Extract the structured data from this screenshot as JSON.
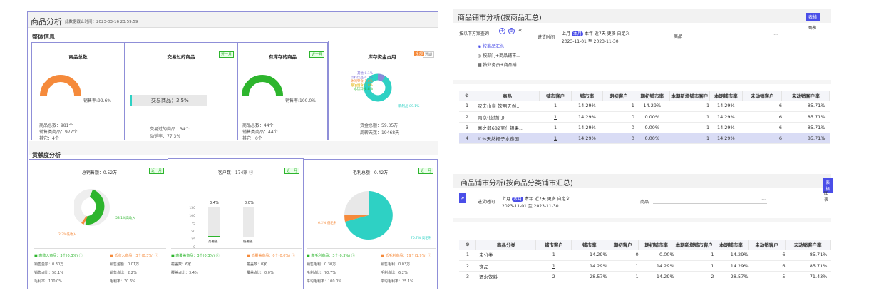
{
  "left": {
    "title": "商品分析",
    "deadline": "此数据截止时间：2023-03-16 23:59:59",
    "overview_label": "整体信息",
    "contribution_label": "贡献度分析",
    "recent_month": "近一月",
    "recent_month_sm": "近一月",
    "btn_all": "全部",
    "btn_recent": "近期",
    "cards": {
      "total": {
        "title": "商品总数",
        "rate": "销售率:99.6%",
        "lines": [
          "商品总数：981个",
          "销售类商品：977个",
          "其它：4个"
        ],
        "rate_value": 99.6
      },
      "traded": {
        "title": "交易过的商品",
        "bar_label": "交易商品：3.5%",
        "lines": [
          "交易过的商品：34个",
          "动销率：77.3%"
        ],
        "bar_value": 3.5
      },
      "stock": {
        "title": "有库存的商品",
        "rate": "销售率:100.0%",
        "lines": [
          "商品总数：44个",
          "销售类商品：44个",
          "其它：0个"
        ],
        "rate_value": 100.0
      },
      "capital": {
        "title": "库存资金占用",
        "labels": [
          "其他-0.1%",
          "饮料饮品-0.2%",
          "休闲零食-1.0%",
          "粮油副食-2.8%",
          "水饮料-6.8%",
          "乳制品-89.1%"
        ],
        "lines": [
          "资金总额：59.35万",
          "周转天数：19468天"
        ]
      }
    },
    "contrib": {
      "sales": {
        "title": "总销售额：0.52万",
        "big_label": "58.1%高收入",
        "small_label": "2.3%低收入",
        "left": [
          "■ 高收入商品：3个(0.3%) ⓘ",
          "销售金额：0.30万",
          "销售占比：58.1%",
          "毛利率：100.0%"
        ],
        "right": [
          "■ 低收入商品：3个(0.3%) ⓘ",
          "销售金额：0.01万",
          "销售占比：2.2%",
          "毛利率：70.6%"
        ]
      },
      "customers": {
        "title": "客户数：174家 ⓘ",
        "bar1_label": "3.4%",
        "bar2_label": "0.0%",
        "ticks": [
          "150",
          "100",
          "75",
          "50",
          "25",
          "0"
        ],
        "cats": [
          "高覆盖",
          "低覆盖"
        ],
        "left": [
          "■ 高覆盖商品：3个(0.3%) ⓘ",
          "覆盖数：6家",
          "覆盖占比：3.4%"
        ],
        "right": [
          "■ 低覆盖商品：0个(0.0%) ⓘ",
          "覆盖数：0家",
          "覆盖占比：0.0%"
        ]
      },
      "profit": {
        "title": "毛利总额：0.42万",
        "big_label": "70.7% 高毛利",
        "small_label": "6.2% 低毛利",
        "left": [
          "■ 高毛利商品：3个(0.3%) ⓘ",
          "销售毛利：0.30万",
          "毛利占比：70.7%",
          "平均毛利率：100.0%"
        ],
        "right": [
          "■ 低毛利商品：19个(1.9%) ⓘ",
          "销售毛利：0.03万",
          "毛利占比：6.2%",
          "平均毛利率：25.1%"
        ]
      }
    }
  },
  "right1": {
    "title": "商品铺市分析(按商品汇总)",
    "btn_table": "表格",
    "btn_chart": "图表",
    "query_label": "按以下方案查询",
    "options": [
      "按商品汇总",
      "按部门+商品铺市...",
      "按业务员+商品铺..."
    ],
    "time_label": "进货时间",
    "periods": [
      "上月",
      "本月",
      "本年",
      "近7天",
      "更多",
      "自定义"
    ],
    "date_range": "2023-11-01 至 2023-11-30",
    "goods_label": "商品",
    "more": "···",
    "headers": [
      "商品",
      "铺市客户",
      "铺市率",
      "期初客户",
      "期初铺市率",
      "本期新增铺市客户",
      "本期铺市率",
      "未动销客户",
      "未动销客户率"
    ],
    "rows": [
      [
        "1",
        "农夫山泉 饮用天然...",
        "1",
        "14.29%",
        "1",
        "14.29%",
        "1",
        "14.29%",
        "6",
        "85.71%"
      ],
      [
        "2",
        "南京(炫赫门)",
        "1",
        "14.29%",
        "0",
        "0.00%",
        "1",
        "14.29%",
        "6",
        "85.71%"
      ],
      [
        "3",
        "喜之郎682克什锦果...",
        "1",
        "14.29%",
        "0",
        "0.00%",
        "1",
        "14.29%",
        "6",
        "85.71%"
      ],
      [
        "4",
        "if %天然椰子水泰国...",
        "1",
        "14.29%",
        "0",
        "0.00%",
        "1",
        "14.29%",
        "6",
        "85.71%"
      ]
    ]
  },
  "right2": {
    "title": "商品铺市分析(按商品分类铺市汇总)",
    "btn_table": "表格",
    "btn_chart": "图表",
    "time_label": "进货时间",
    "periods": [
      "上月",
      "本月",
      "本年",
      "近7天",
      "更多",
      "自定义"
    ],
    "date_range": "2023-11-01 至 2023-11-30",
    "goods_label": "商品",
    "more": "···",
    "expand": "»",
    "headers": [
      "商品分类",
      "铺市客户",
      "铺市率",
      "期初客户",
      "期初铺市率",
      "本期新增铺市客户",
      "本期铺市率",
      "未动销客户",
      "未动销客户率"
    ],
    "rows": [
      [
        "1",
        "未分类",
        "1",
        "14.29%",
        "0",
        "0.00%",
        "1",
        "14.29%",
        "6",
        "85.71%"
      ],
      [
        "2",
        "食品",
        "1",
        "14.29%",
        "1",
        "14.29%",
        "1",
        "14.29%",
        "6",
        "85.71%"
      ],
      [
        "3",
        "酒水饮料",
        "2",
        "28.57%",
        "1",
        "14.29%",
        "2",
        "28.57%",
        "5",
        "71.43%"
      ]
    ]
  },
  "colors": {
    "orange": "#f58a3b",
    "green": "#2db52d",
    "teal": "#2ed1c4",
    "blue": "#4a4ee8",
    "purple_border": "#8f8fd8"
  }
}
